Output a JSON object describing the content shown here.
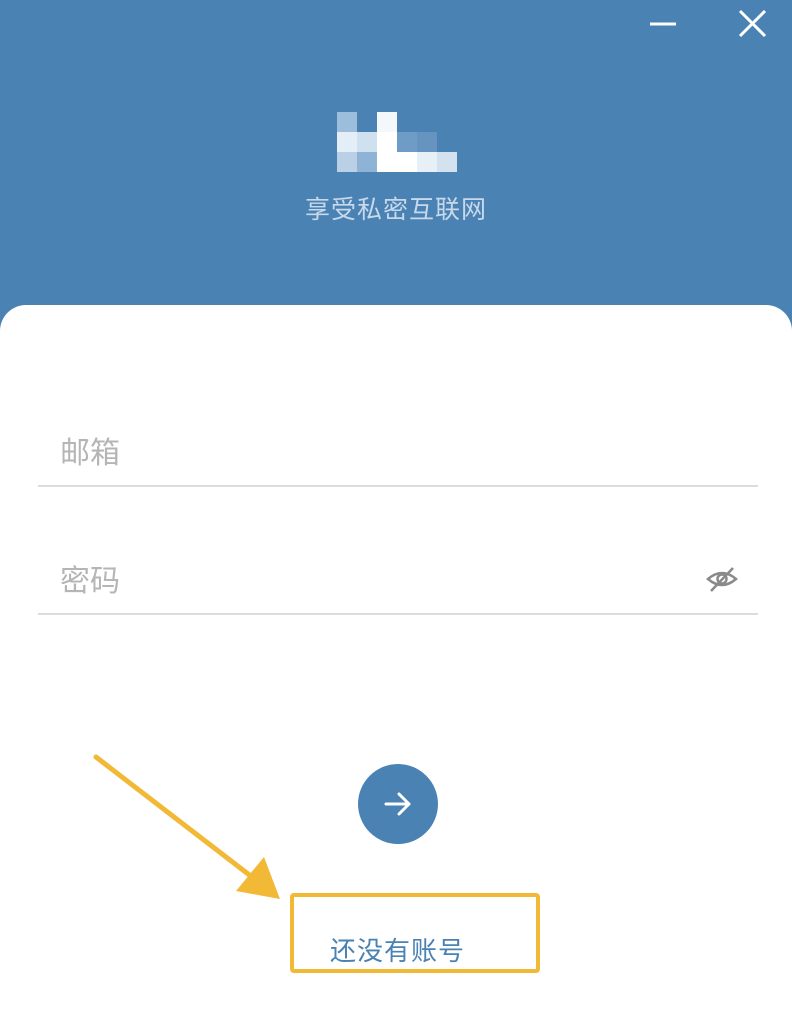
{
  "window_controls": {
    "minimize_icon": "minus-icon",
    "close_icon": "close-icon"
  },
  "header": {
    "logo": "blurred-logo",
    "tagline": "享受私密互联网",
    "background_color": "#4a82b3"
  },
  "form": {
    "email": {
      "placeholder": "邮箱",
      "value": ""
    },
    "password": {
      "placeholder": "密码",
      "value": "",
      "toggle_icon": "eye-slash-icon"
    },
    "submit_icon": "arrow-right-icon"
  },
  "register": {
    "label": "还没有账号"
  },
  "annotation": {
    "highlight_color": "#f2b936",
    "arrow_icon": "annotation-arrow"
  }
}
